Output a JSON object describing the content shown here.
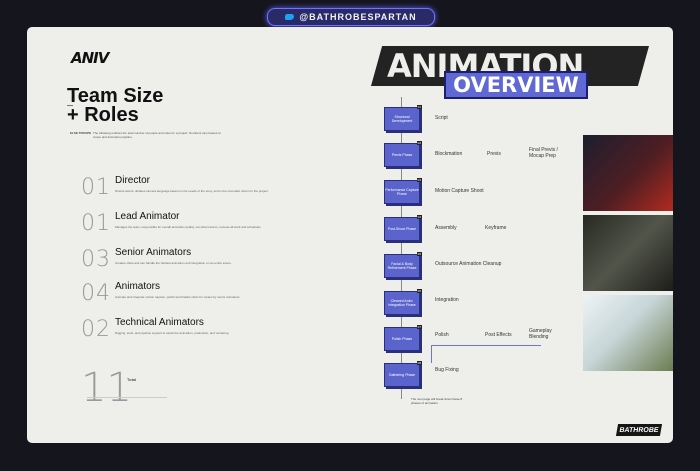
{
  "handle": "@BATHROBESPARTAN",
  "left": {
    "logo": "ANIV",
    "title": "Team Size + Roles",
    "label": "ELSE TROUPE",
    "intro": "The following outlines the total number of people and roles for a project. Numbers vary based on scope and animation pipeline.",
    "roles": [
      {
        "number": "01",
        "title": "Director",
        "desc": "Directs actors, dictates camera language based on the needs of the story, and is the cinematic vision for the project."
      },
      {
        "number": "01",
        "title": "Lead Animator",
        "desc": "Manages the team, responsible for overall animation quality, can direct actors, reviews all work and schedules."
      },
      {
        "number": "03",
        "title": "Senior Animators",
        "desc": "Creates shots and can handle the hardest animation and integration on an entire scene."
      },
      {
        "number": "04",
        "title": "Animators",
        "desc": "Animate and integrate motion capture, polish and finalize shots for review by senior animators."
      },
      {
        "number": "02",
        "title": "Technical Animators",
        "desc": "Rigging, tools, and pipeline support to assist the animation, production, and rendering."
      }
    ],
    "total_number": "11",
    "total_label": "Total"
  },
  "right": {
    "heading": "ANIMATION",
    "subheading": "OVERVIEW",
    "phases": [
      {
        "no": "01",
        "label": "Structural Development"
      },
      {
        "no": "02",
        "label": "Previs Phase"
      },
      {
        "no": "03",
        "label": "Performance Capture Phase"
      },
      {
        "no": "04",
        "label": "Post-Shoot Phase"
      },
      {
        "no": "05",
        "label": "Facial & Body Refinement Phase"
      },
      {
        "no": "06",
        "label": "Cleaned Anim. Integration Phase"
      },
      {
        "no": "07",
        "label": "Polish Phase"
      },
      {
        "no": "08",
        "label": "Gathering Phase"
      }
    ],
    "flow": {
      "script": "Script",
      "blockmation": "Blockmation",
      "previs": "Previs",
      "final_previs": "Final Previs / Mocap Prep",
      "mocap": "Motion Capture Shoot",
      "assembly": "Assembly",
      "keyframe": "Keyframe",
      "outsource": "Outsource Animation Cleanup",
      "integration": "Integration",
      "polish": "Polish",
      "post_effects": "Post Effects",
      "gameplay": "Gameplay Blending",
      "bug": "Bug Fixing"
    },
    "note": "The next page will break down these 8 phases of animation.",
    "brand": "BATHROBE"
  }
}
